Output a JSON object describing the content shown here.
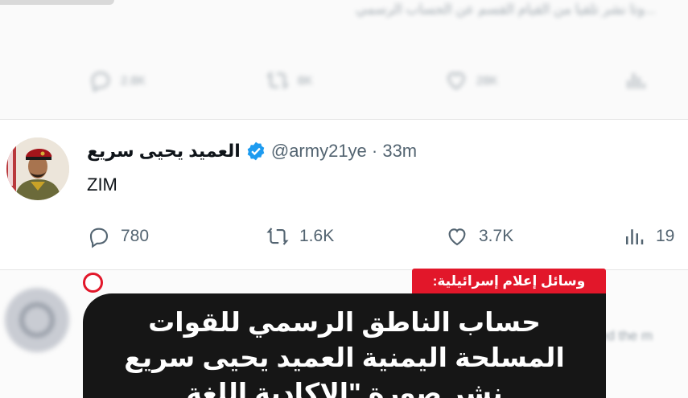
{
  "top_tweet": {
    "text": "...وتا نشر تلقيا من القيام القسم عن الحساب الرسمي",
    "stats": [
      {
        "icon": "reply-icon",
        "value": "2.8K"
      },
      {
        "icon": "retweet-icon",
        "value": "8K"
      },
      {
        "icon": "like-icon",
        "value": "28K"
      },
      {
        "icon": "views-icon",
        "value": ""
      }
    ]
  },
  "tweet": {
    "display_name": "العميد يحيى سريع",
    "handle": "@army21ye · 33m",
    "text": "ZIM",
    "actions": {
      "replies": "780",
      "retweets": "1.6K",
      "likes": "3.7K",
      "views": "19"
    }
  },
  "bottom_tweet": {
    "blurred_text": "ed the m"
  },
  "news": {
    "tag": "وسائل إعلام إسرائيلية:",
    "headline_lines": [
      "حساب الناطق الرسمي للقوات",
      "المسلحة اليمنية العميد يحيى سريع",
      "نشر صورة \"الاكادية اللغة"
    ]
  },
  "colors": {
    "accent_red": "#e2172a",
    "verified_blue": "#1d9bf0",
    "card_dark": "#161616",
    "muted_text": "#536471"
  }
}
